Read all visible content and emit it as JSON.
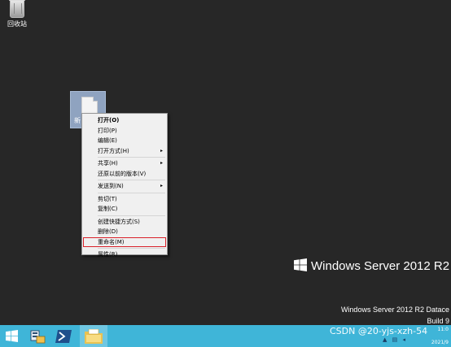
{
  "desktop": {
    "recycle_bin_label": "回收站",
    "selected_file_label": "新"
  },
  "context_menu": {
    "items": [
      {
        "label": "打开(O)",
        "bold": true
      },
      {
        "label": "打印(P)"
      },
      {
        "label": "编辑(E)"
      },
      {
        "label": "打开方式(H)",
        "submenu": true
      },
      {
        "label": "共享(H)",
        "submenu": true
      },
      {
        "label": "还原以前的版本(V)"
      },
      {
        "label": "发送到(N)",
        "submenu": true
      },
      {
        "label": "剪切(T)"
      },
      {
        "label": "复制(C)"
      },
      {
        "label": "创建快捷方式(S)"
      },
      {
        "label": "删除(D)"
      },
      {
        "label": "重命名(M)",
        "highlighted": true
      },
      {
        "label": "属性(R)"
      }
    ],
    "arrow_glyph": "▸"
  },
  "branding": {
    "product": "Windows Server 2012 R2",
    "edition": "Windows Server 2012 R2 Datace",
    "build": "Build 9"
  },
  "taskbar": {
    "watermark": "CSDN @20-yjs-xzh-54",
    "time": "11:0",
    "date": "2021/9"
  },
  "colors": {
    "desktop_bg": "#272727",
    "taskbar_bg": "#3fb5d8",
    "menu_bg": "#f0f0f0",
    "highlight_border": "#d9212a"
  }
}
